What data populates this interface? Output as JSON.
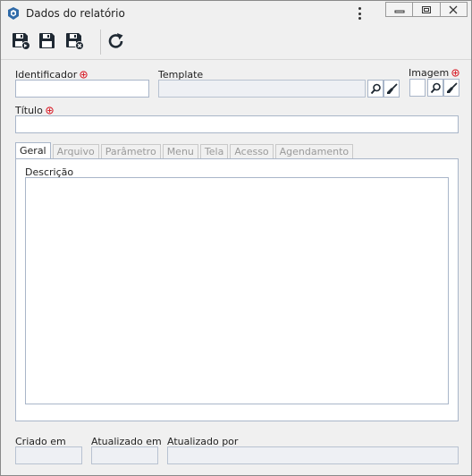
{
  "window": {
    "title": "Dados do relatório"
  },
  "toolbar": {
    "buttons": [
      {
        "name": "save-and-new-button",
        "icon": "floppy-with-arrow-icon"
      },
      {
        "name": "save-button",
        "icon": "floppy-icon"
      },
      {
        "name": "save-and-close-button",
        "icon": "floppy-with-x-icon"
      },
      {
        "name": "refresh-button",
        "icon": "refresh-icon"
      }
    ]
  },
  "form": {
    "identificador": {
      "label": "Identificador",
      "value": "",
      "required": true
    },
    "template": {
      "label": "Template",
      "value": ""
    },
    "imagem": {
      "label": "Imagem",
      "value": "",
      "required": true
    },
    "titulo": {
      "label": "Título",
      "value": "",
      "required": true
    }
  },
  "tabs": [
    {
      "label": "Geral",
      "active": true
    },
    {
      "label": "Arquivo",
      "active": false
    },
    {
      "label": "Parâmetro",
      "active": false
    },
    {
      "label": "Menu",
      "active": false
    },
    {
      "label": "Tela",
      "active": false
    },
    {
      "label": "Acesso",
      "active": false
    },
    {
      "label": "Agendamento",
      "active": false
    }
  ],
  "geral": {
    "descricao_label": "Descrição",
    "descricao_value": ""
  },
  "footer": {
    "criado_em": {
      "label": "Criado em",
      "value": ""
    },
    "atualizado_em": {
      "label": "Atualizado em",
      "value": ""
    },
    "atualizado_por": {
      "label": "Atualizado por",
      "value": ""
    }
  },
  "colors": {
    "required_marker": "#d9232e",
    "field_border": "#a9b6c9",
    "readonly_field": "#eef0f4",
    "window_bg": "#f0f0f0"
  }
}
